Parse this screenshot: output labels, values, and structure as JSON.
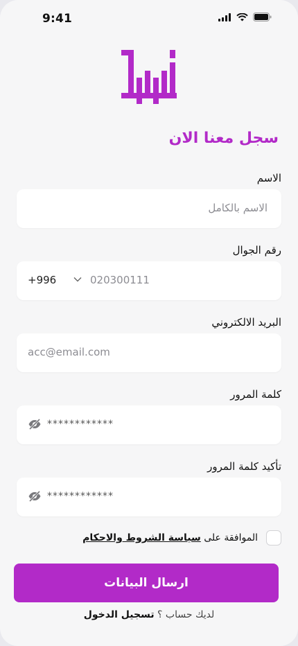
{
  "status_bar": {
    "time": "9:41"
  },
  "brand": {
    "accent_color": "#b22ac8",
    "logo": "brand-logo"
  },
  "form": {
    "title": "سجل معنا الان",
    "name": {
      "label": "الاسم",
      "placeholder": "الاسم بالكامل"
    },
    "phone": {
      "label": "رقم الجوال",
      "country_code": "+996",
      "placeholder": "020300111"
    },
    "email": {
      "label": "البريد الالكتروني",
      "placeholder": "acc@email.com"
    },
    "password": {
      "label": "كلمة المرور",
      "value": "************"
    },
    "confirm_password": {
      "label": "تأكيد كلمة المرور",
      "value": "************"
    },
    "agree": {
      "prefix": "الموافقة على",
      "link": "سياسة الشروط والاحكام",
      "checked": false
    },
    "submit_label": "ارسال البيانات",
    "login": {
      "prompt": "لديك حساب ؟",
      "link": "تسجيل الدخول"
    }
  }
}
